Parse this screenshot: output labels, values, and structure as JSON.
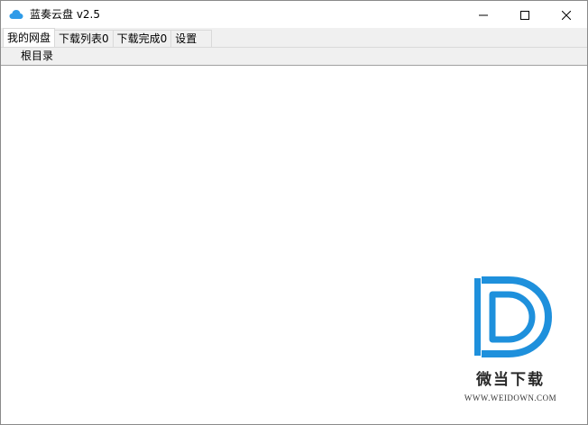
{
  "window": {
    "title": "蓝奏云盘 v2.5",
    "app_icon": "cloud-icon",
    "controls": {
      "minimize_icon": "minimize-icon",
      "maximize_icon": "maximize-icon",
      "close_icon": "close-icon"
    }
  },
  "tabs": [
    {
      "label": "我的网盘",
      "active": true
    },
    {
      "label": "下载列表0",
      "active": false
    },
    {
      "label": "下载完成0",
      "active": false
    },
    {
      "label": "设置",
      "active": false
    }
  ],
  "path": {
    "label": "根目录"
  },
  "watermark": {
    "brand_cn": "微当下载",
    "url": "WWW.WEIDOWN.COM",
    "logo_icon": "weidown-d-logo",
    "color": "#1e90dc"
  },
  "colors": {
    "cloud_icon": "#2f9be8",
    "tab_bg": "#f0f0f0",
    "tab_active_bg": "#ffffff"
  }
}
